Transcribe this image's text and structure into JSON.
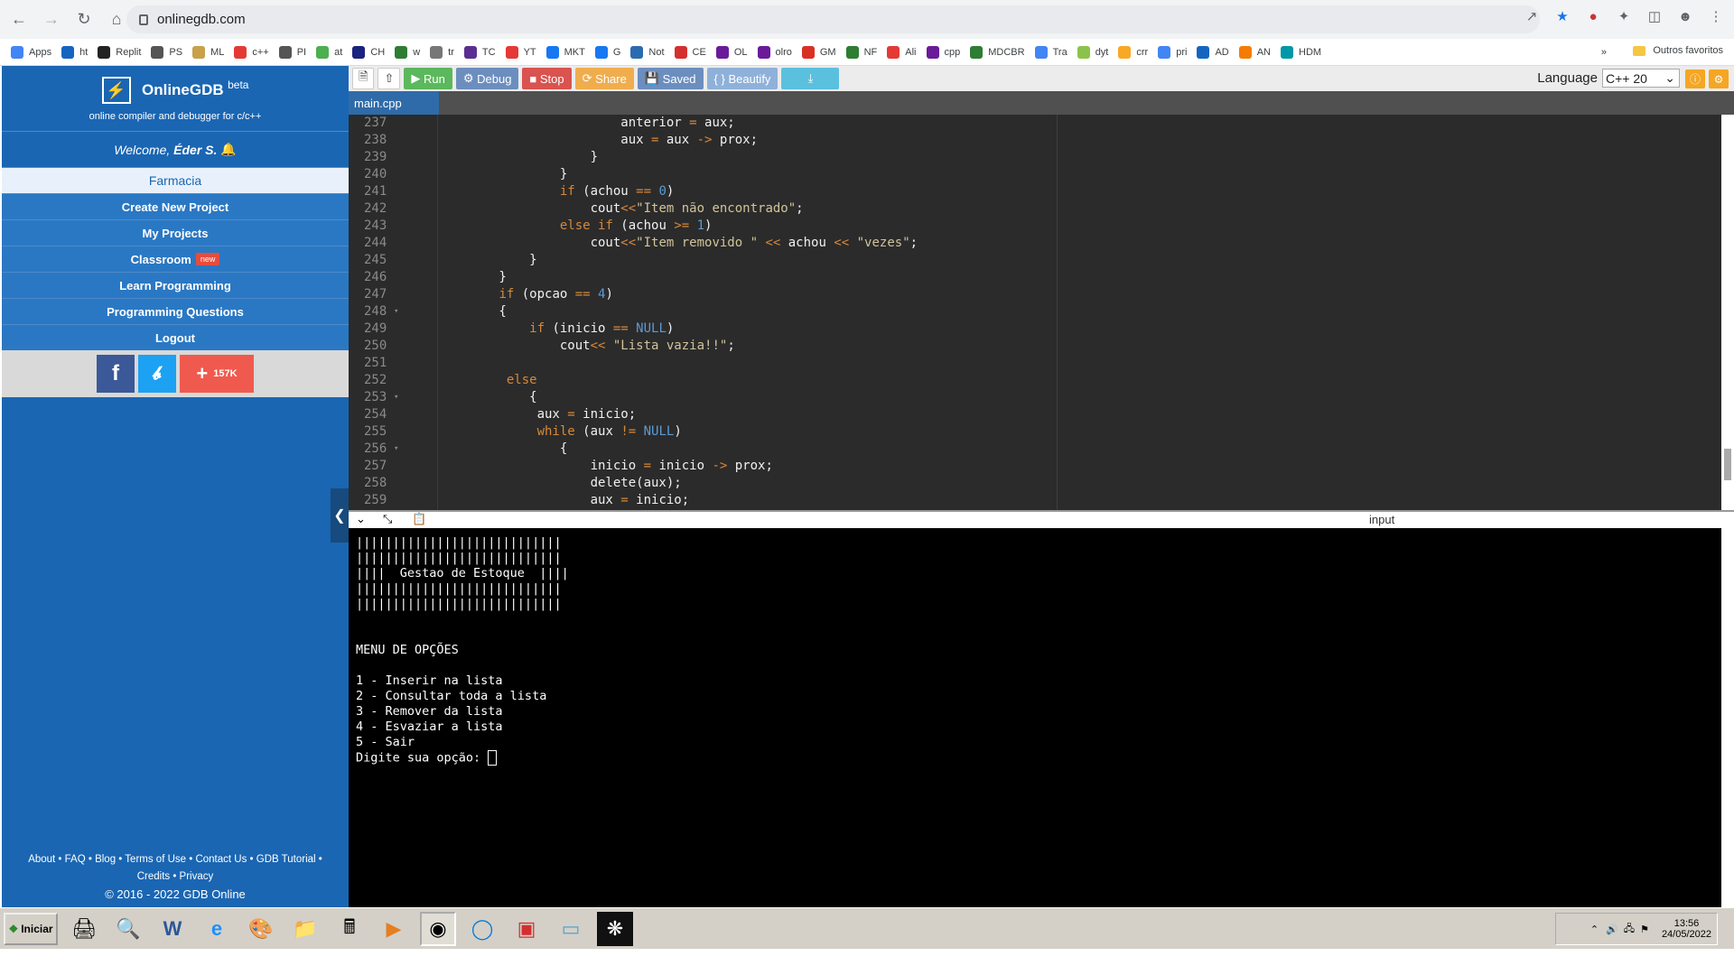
{
  "browser": {
    "url": "onlinegdb.com",
    "bookmarks": [
      "Apps",
      "ht",
      "Replit",
      "PS",
      "ML",
      "c++",
      "PI",
      "at",
      "CH",
      "w",
      "tr",
      "TC",
      "YT",
      "MKT",
      "G",
      "Not",
      "CE",
      "OL",
      "olro",
      "GM",
      "NF",
      "Ali",
      "cpp",
      "MDCBR",
      "Tra",
      "dyt",
      "crr",
      "pri",
      "AD",
      "AN",
      "HDM"
    ],
    "other_bookmarks": "Outros favoritos",
    "more": "»"
  },
  "sidebar": {
    "brand": "OnlineGDB",
    "beta": "beta",
    "tagline": "online compiler and debugger for c/c++",
    "welcome": "Welcome,",
    "user": "Éder S.",
    "project": "Farmacia",
    "menu": [
      "Create New Project",
      "My Projects",
      "Classroom",
      "Learn Programming",
      "Programming Questions",
      "Logout"
    ],
    "new_badge": "new",
    "share_count": "157K",
    "footer_line1": "About • FAQ • Blog • Terms of Use • Contact Us • GDB Tutorial •",
    "footer_line2": "Credits • Privacy",
    "copyright": "© 2016 - 2022 GDB Online"
  },
  "toolbar": {
    "run": "Run",
    "debug": "Debug",
    "stop": "Stop",
    "share": "Share",
    "saved": "Saved",
    "beautify": "{ } Beautify",
    "language_label": "Language",
    "language": "C++ 20"
  },
  "editor": {
    "file_tab": "main.cpp",
    "line_numbers": [
      "237",
      "238",
      "239",
      "240",
      "241",
      "242",
      "243",
      "244",
      "245",
      "246",
      "247",
      "248",
      "249",
      "250",
      "251",
      "252",
      "253",
      "254",
      "255",
      "256",
      "257",
      "258",
      "259"
    ]
  },
  "console": {
    "title": "input",
    "output": "||||||||||||||||||||||||||||\n||||||||||||||||||||||||||||\n||||  Gestao de Estoque  ||||\n||||||||||||||||||||||||||||\n||||||||||||||||||||||||||||\n\n\nMENU DE OPÇÕES\n\n1 - Inserir na lista\n2 - Consultar toda a lista\n3 - Remover da lista\n4 - Esvaziar a lista\n5 - Sair\nDigite sua opção: "
  },
  "taskbar": {
    "start": "Iniciar",
    "time": "13:56",
    "date": "24/05/2022"
  },
  "colors": {
    "sidebar": "#1a66b3",
    "run": "#5cb85c",
    "stop": "#d9534f",
    "debug": "#6c8ebf",
    "download": "#5bc0de",
    "editor_bg": "#2b2b2b"
  }
}
